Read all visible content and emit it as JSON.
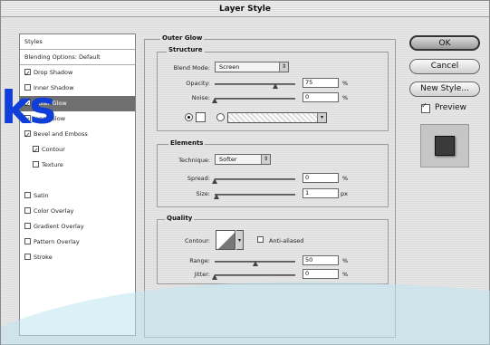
{
  "window": {
    "title": "Layer Style"
  },
  "sidebar": {
    "items": [
      {
        "label": "Styles",
        "checkbox": false,
        "checked": false,
        "header": true
      },
      {
        "label": "Blending Options: Default",
        "checkbox": false,
        "checked": false,
        "header": true
      },
      {
        "label": "Drop Shadow",
        "checkbox": true,
        "checked": true
      },
      {
        "label": "Inner Shadow",
        "checkbox": true,
        "checked": false
      },
      {
        "label": "Outer Glow",
        "checkbox": true,
        "checked": true,
        "selected": true
      },
      {
        "label": "Inner Glow",
        "checkbox": true,
        "checked": true
      },
      {
        "label": "Bevel and Emboss",
        "checkbox": true,
        "checked": true
      },
      {
        "label": "Contour",
        "checkbox": true,
        "checked": true,
        "indent": true
      },
      {
        "label": "Texture",
        "checkbox": true,
        "checked": false,
        "indent": true
      },
      {
        "label": "Satin",
        "checkbox": true,
        "checked": false
      },
      {
        "label": "Color Overlay",
        "checkbox": true,
        "checked": false
      },
      {
        "label": "Gradient Overlay",
        "checkbox": true,
        "checked": false
      },
      {
        "label": "Pattern Overlay",
        "checkbox": true,
        "checked": false
      },
      {
        "label": "Stroke",
        "checkbox": true,
        "checked": false
      }
    ],
    "overlay_text": "ks"
  },
  "outer_glow": {
    "title": "Outer Glow",
    "structure": {
      "title": "Structure",
      "blend_mode_label": "Blend Mode:",
      "blend_mode_value": "Screen",
      "opacity_label": "Opacity:",
      "opacity_value": "75",
      "opacity_unit": "%",
      "noise_label": "Noise:",
      "noise_value": "0",
      "noise_unit": "%"
    },
    "elements": {
      "title": "Elements",
      "technique_label": "Technique:",
      "technique_value": "Softer",
      "spread_label": "Spread:",
      "spread_value": "0",
      "spread_unit": "%",
      "size_label": "Size:",
      "size_value": "1",
      "size_unit": "px"
    },
    "quality": {
      "title": "Quality",
      "contour_label": "Contour:",
      "antialiased_label": "Anti-aliased",
      "range_label": "Range:",
      "range_value": "50",
      "range_unit": "%",
      "jitter_label": "Jitter:",
      "jitter_value": "0",
      "jitter_unit": "%"
    }
  },
  "sliders": {
    "opacity": 0.75,
    "noise": 0.0,
    "spread": 0.0,
    "size": 0.02,
    "range": 0.5,
    "jitter": 0.0
  },
  "buttons": {
    "ok": "OK",
    "cancel": "Cancel",
    "new_style": "New Style...",
    "preview_label": "Preview"
  },
  "colors": {
    "accent_text": "#0f3fd8",
    "selected_row": "#6f6f6f",
    "wave": "#bfe3f0"
  }
}
